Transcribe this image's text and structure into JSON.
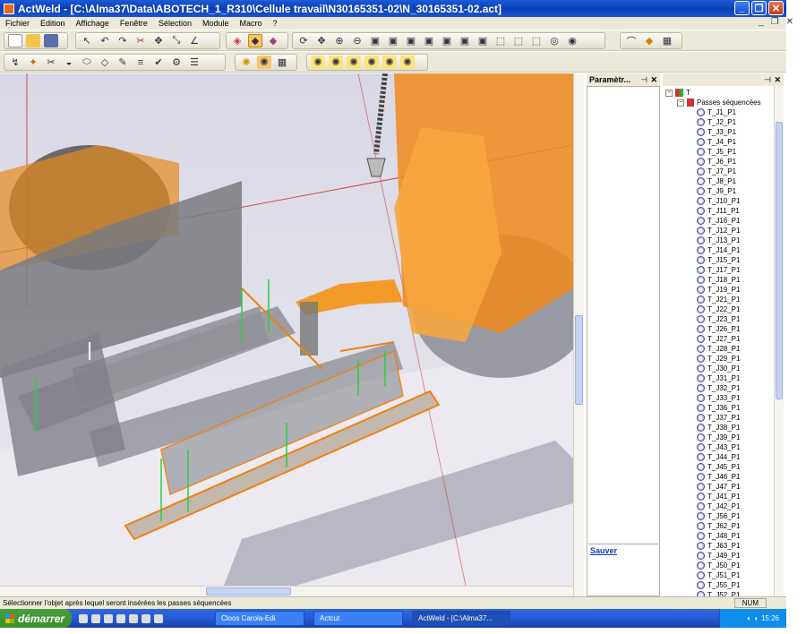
{
  "window": {
    "title": "ActWeld - [C:\\Alma37\\Data\\ABOTECH_1_R310\\Cellule travail\\N30165351-02\\N_30165351-02.act]",
    "min": "_",
    "max": "❐",
    "close": "✕"
  },
  "menu": [
    "Fichier",
    "Edition",
    "Affichage",
    "Fenêtre",
    "Sélection",
    "Module",
    "Macro",
    "?"
  ],
  "mdi": [
    "_",
    "❐",
    "✕"
  ],
  "panels": {
    "param_title": "Paramètr...",
    "pin": "⊣",
    "close": "✕",
    "sauver": "Sauver"
  },
  "tree": {
    "root": "T",
    "group": "Passes séquencées",
    "items": [
      "T_J1_P1",
      "T_J2_P1",
      "T_J3_P1",
      "T_J4_P1",
      "T_J5_P1",
      "T_J6_P1",
      "T_J7_P1",
      "T_J8_P1",
      "T_J9_P1",
      "T_J10_P1",
      "T_J11_P1",
      "T_J16_P1",
      "T_J12_P1",
      "T_J13_P1",
      "T_J14_P1",
      "T_J15_P1",
      "T_J17_P1",
      "T_J18_P1",
      "T_J19_P1",
      "T_J21_P1",
      "T_J22_P1",
      "T_J23_P1",
      "T_J26_P1",
      "T_J27_P1",
      "T_J28_P1",
      "T_J29_P1",
      "T_J30_P1",
      "T_J31_P1",
      "T_J32_P1",
      "T_J33_P1",
      "T_J36_P1",
      "T_J37_P1",
      "T_J38_P1",
      "T_J39_P1",
      "T_J43_P1",
      "T_J44_P1",
      "T_J45_P1",
      "T_J46_P1",
      "T_J47_P1",
      "T_J41_P1",
      "T_J42_P1",
      "T_J56_P1",
      "T_J62_P1",
      "T_J48_P1",
      "T_J63_P1",
      "T_J49_P1",
      "T_J50_P1",
      "T_J51_P1",
      "T_J55_P1",
      "T_J52_P1"
    ]
  },
  "status": {
    "message": "Sélectionner l'objet après lequel seront insérées les passes séquencées",
    "num": "NUM"
  },
  "taskbar": {
    "start": "démarrer",
    "tasks": [
      "Cloos Carola-Edi",
      "Actcut",
      "ActWeld - [C:\\Alma37..."
    ],
    "clock": "15:26"
  }
}
